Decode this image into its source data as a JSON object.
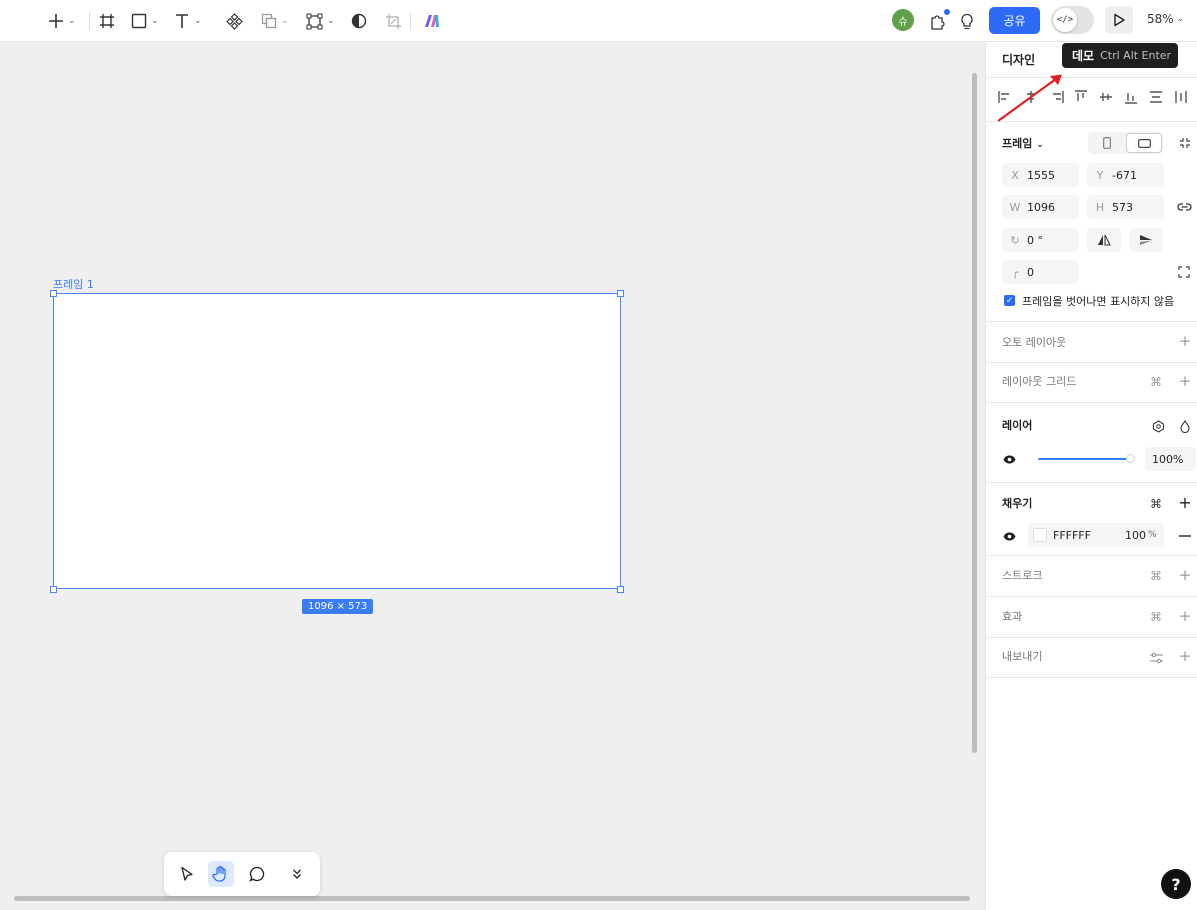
{
  "toolbar": {
    "tools": [
      "add-tool",
      "frame-tool",
      "shape-tool",
      "text-tool",
      "component-tool",
      "boolean-tool",
      "vector-tool",
      "mask-tool",
      "crop-tool",
      "ai-tool"
    ],
    "avatar_initial": "슈",
    "share_label": "공유",
    "dev_mode_label": "</>",
    "zoom_label": "58%"
  },
  "tooltip": {
    "title": "데모",
    "shortcut": "Ctrl Alt Enter"
  },
  "canvas": {
    "frame_label": "프레임 1",
    "frame_size_badge": "1096 × 573",
    "frame_fill": "#FFFFFF",
    "selection_color": "#4A86F7"
  },
  "panel": {
    "tab_design": "디자인",
    "frame_section_label": "프레임",
    "x_label": "X",
    "x_value": "1555",
    "y_label": "Y",
    "y_value": "-671",
    "w_label": "W",
    "w_value": "1096",
    "h_label": "H",
    "h_value": "573",
    "rotation_value": "0 °",
    "radius_value": "0",
    "clip_content_label": "프레임을 벗어나면 표시하지 않음",
    "clip_content_checked": true,
    "auto_layout_label": "오토 레이아웃",
    "layout_grid_label": "레이아웃 그리드",
    "layer_label": "레이어",
    "layer_opacity": "100%",
    "fill_label": "채우기",
    "fill_hex": "FFFFFF",
    "fill_opacity": "100",
    "fill_opacity_unit": "%",
    "stroke_label": "스트로크",
    "effects_label": "효과",
    "export_label": "내보내기"
  },
  "bottom_tools": [
    "move-tool",
    "hand-tool",
    "comment-tool",
    "more-tools"
  ],
  "help_label": "?",
  "colors": {
    "accent": "#2D6BF6",
    "avatar": "#5FA049",
    "arrow": "#E02020"
  }
}
